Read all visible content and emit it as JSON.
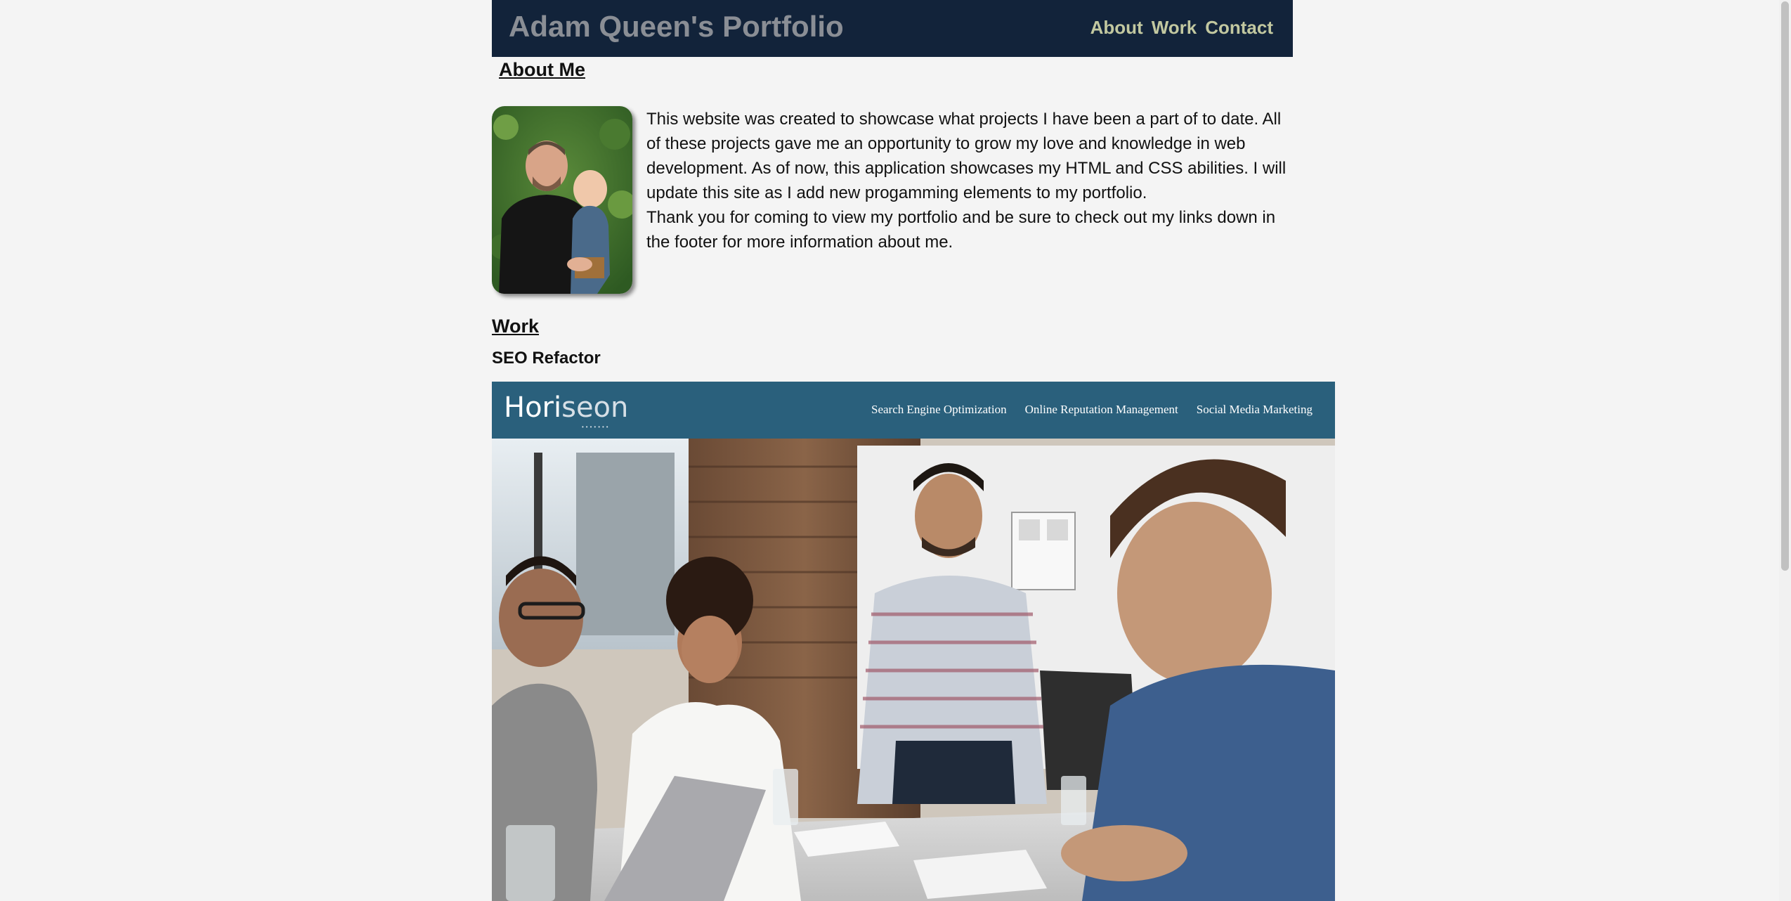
{
  "header": {
    "title": "Adam Queen's Portfolio",
    "nav": [
      "About",
      "Work",
      "Contact"
    ]
  },
  "about": {
    "heading": "About Me",
    "paragraph1": "This website was created to showcase what projects I have been a part of to date. All of these projects gave me an opportunity to grow my love and knowledge in web development. As of now, this application showcases my HTML and CSS abilities. I will update this site as I add new progamming elements to my portfolio.",
    "paragraph2": "Thank you for coming to view my portfolio and be sure to check out my links down in the footer for more information about me."
  },
  "work": {
    "heading": "Work",
    "projects": [
      {
        "title": "SEO Refactor",
        "screenshot": {
          "logo_part1": "Hori",
          "logo_part2": "seon",
          "nav": [
            "Search Engine Optimization",
            "Online Reputation Management",
            "Social Media Marketing"
          ]
        }
      }
    ]
  },
  "colors": {
    "header_bg": "#12233a",
    "title": "#8a8e95",
    "nav_link": "#c2c8a0",
    "horiseon_bar": "#2a607c"
  }
}
